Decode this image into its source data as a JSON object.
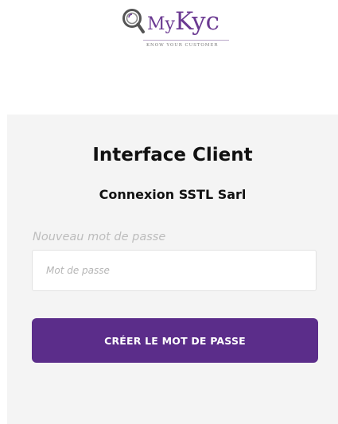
{
  "logo": {
    "brand_prefix": "My",
    "brand_main": "Kyc",
    "tagline": "KNOW YOUR CUSTOMER",
    "icon": "magnifier-icon",
    "color": "#6b3a92"
  },
  "card": {
    "title": "Interface Client",
    "subtitle": "Connexion SSTL Sarl",
    "background": "#f4f4f4"
  },
  "form": {
    "password_label": "Nouveau mot de passe",
    "password_placeholder": "Mot de passe",
    "password_value": "",
    "submit_label": "CRÉER LE MOT DE PASSE",
    "submit_color": "#5b2d8a"
  }
}
